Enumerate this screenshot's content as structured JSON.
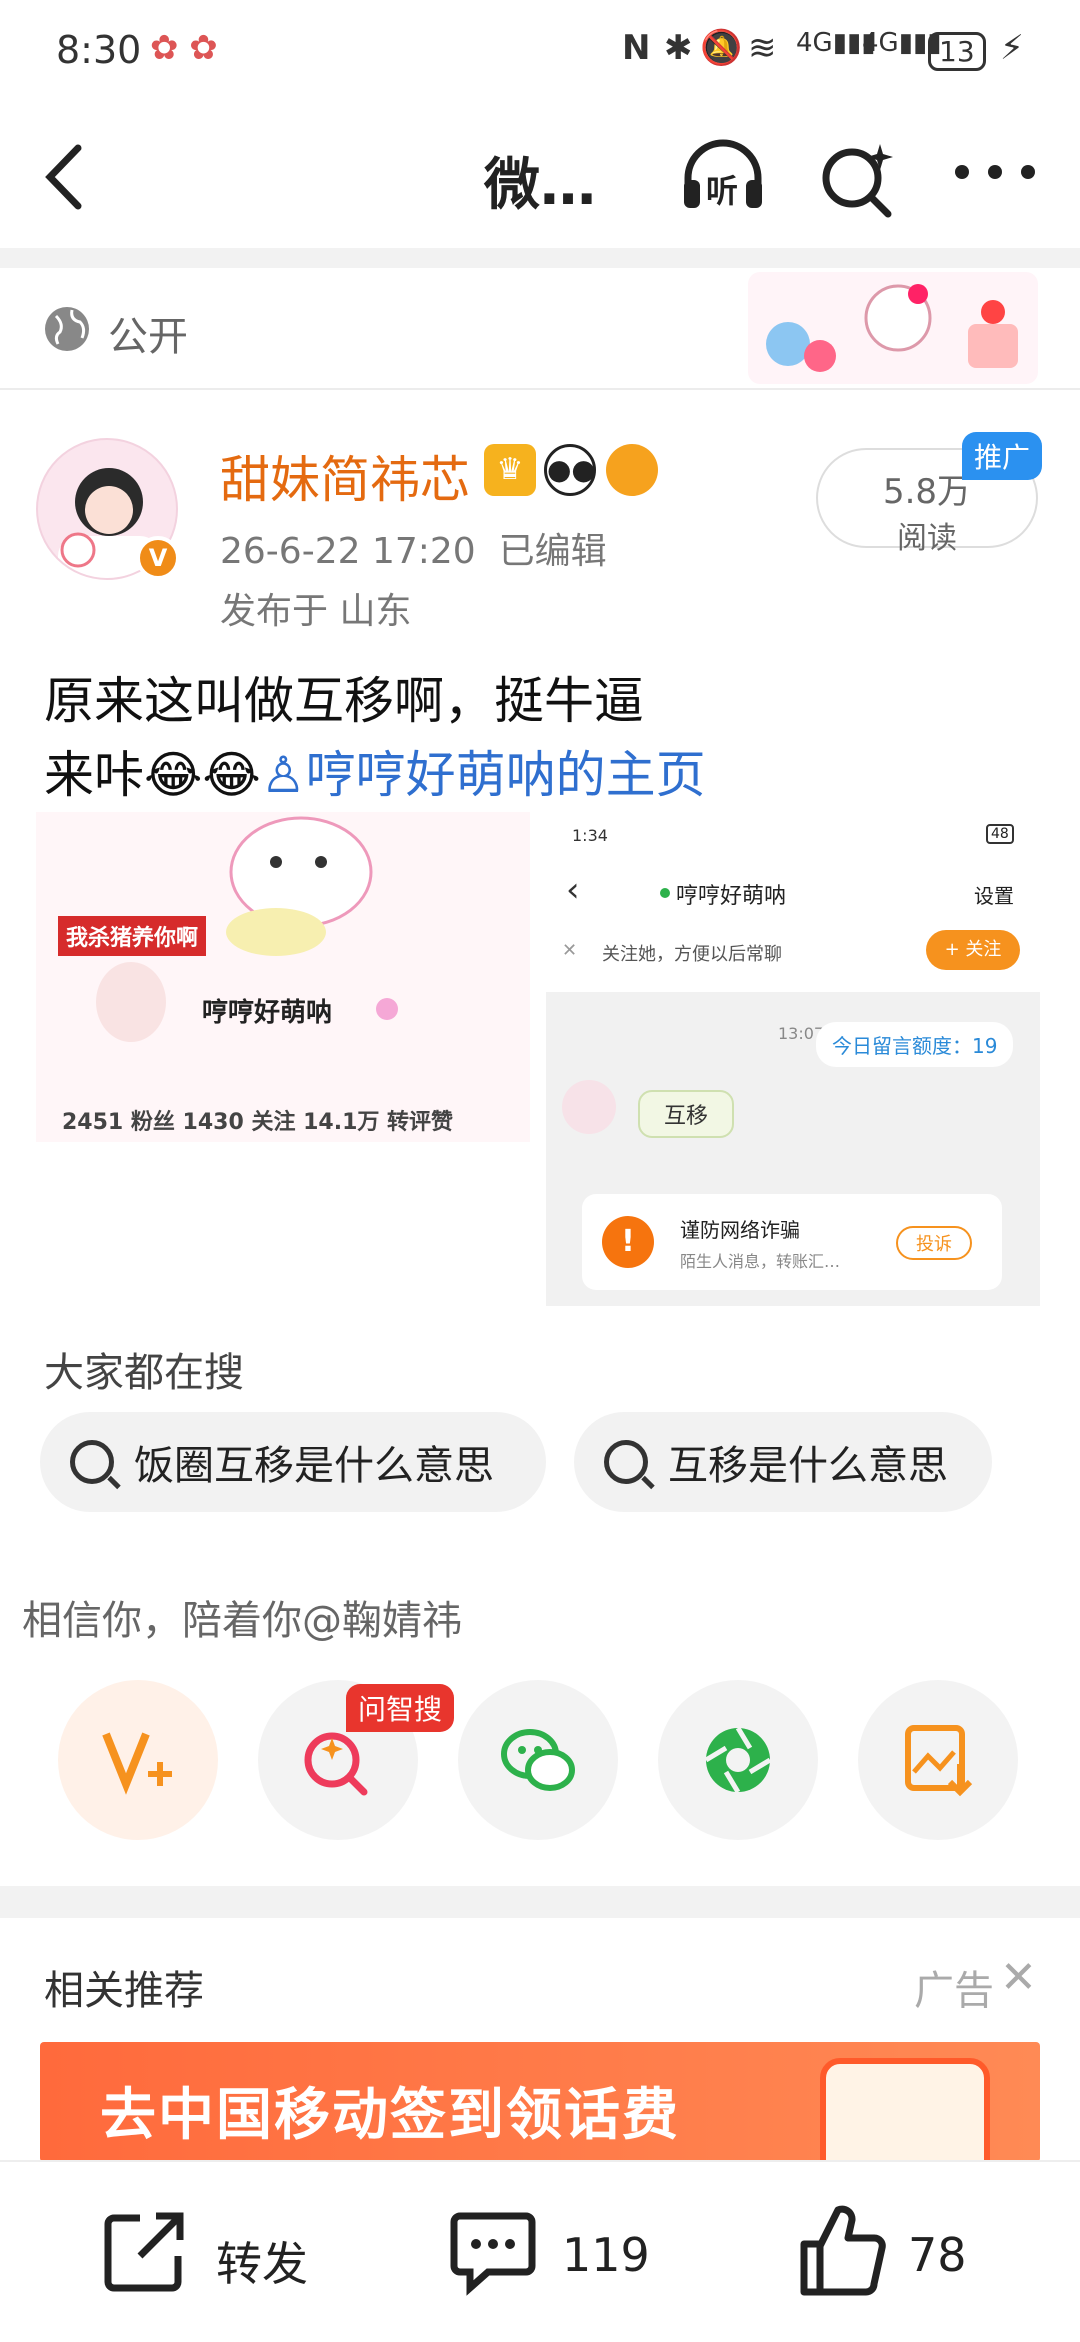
{
  "status": {
    "time": "8:30",
    "battery": "13"
  },
  "header": {
    "title": "微…",
    "listen_label": "听"
  },
  "visibility": {
    "label": "公开"
  },
  "post": {
    "username": "甜妹简祎芯",
    "datetime": "26-6-22 17:20",
    "edited": "已编辑",
    "location": "发布于 山东",
    "reads_value": "5.8万",
    "reads_label": "阅读",
    "promote": "推广",
    "text_line1": "原来这叫做互移啊，挺牛逼",
    "text_line2_prefix": "来咔😂😂",
    "mention": "哼哼好萌呐的主页"
  },
  "image1": {
    "tag": "我杀猪养你啊",
    "name": "哼哼好萌呐",
    "stats": "2451 粉丝    1430 关注    14.1万 转评赞"
  },
  "image2": {
    "time": "1:34",
    "battery": "48",
    "chat_name": "哼哼好萌呐",
    "settings": "设置",
    "follow_tip": "关注她，方便以后常聊",
    "follow_btn": "+ 关注",
    "msg_time": "13:07",
    "quota": "今日留言额度：19",
    "bubble": "互移",
    "warn_title": "谨防网络诈骗",
    "warn_sub": "陌生人消息，转账汇…",
    "report": "投诉"
  },
  "search": {
    "heading": "大家都在搜",
    "chips": [
      "饭圈互移是什么意思",
      "互移是什么意思"
    ]
  },
  "companion": "相信你，陪着你@鞠婧祎",
  "share": {
    "badge": "问智搜"
  },
  "related": {
    "heading": "相关推荐",
    "ad": "广告"
  },
  "banner": {
    "text": "去中国移动签到领话费"
  },
  "actions": {
    "repost": "转发",
    "comments": "119",
    "likes": "78"
  }
}
